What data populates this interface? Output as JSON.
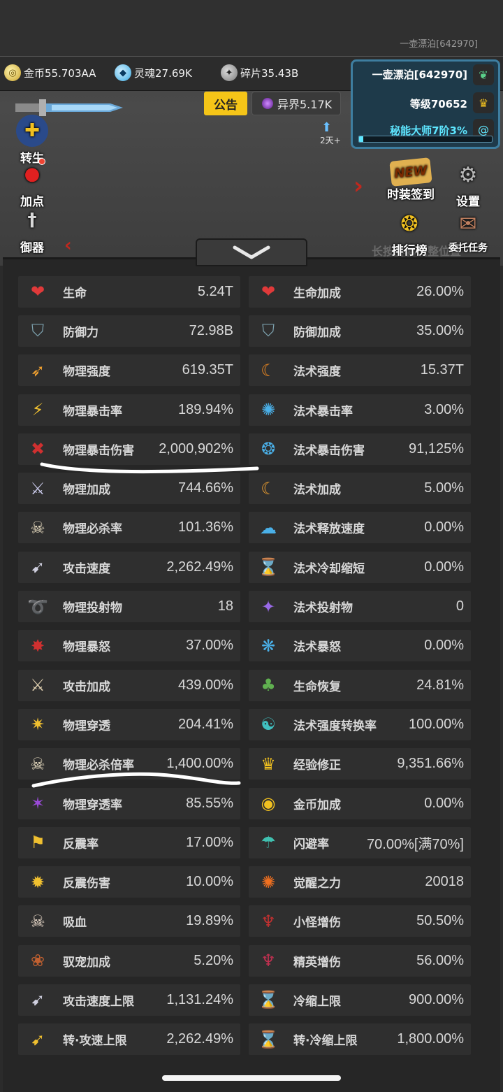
{
  "header": {
    "player_top": "一壶漂泊[642970]",
    "resources": [
      {
        "label": "金币55.703AA",
        "icon": "gold-coin-icon"
      },
      {
        "label": "灵魂27.69K",
        "icon": "soul-icon"
      },
      {
        "label": "碎片35.43B",
        "icon": "shard-icon"
      }
    ],
    "notice_label": "公告",
    "realm_label": "异界5.17K",
    "days_label": "2天+"
  },
  "player_panel": {
    "name": "一壶漂泊[642970]",
    "level": "等级70652",
    "rank": "秘能大师7阶3%",
    "progress_percent": 3
  },
  "side_buttons": [
    {
      "label": "转生"
    },
    {
      "label": "加点"
    },
    {
      "label": "御器"
    }
  ],
  "right_buttons": {
    "new_tag": "NEW",
    "sign_in": "时装签到",
    "settings": "设置",
    "leaderboard": "排行榜",
    "commission": "委托任务",
    "hint": "长按屏幕调整位置"
  },
  "stats": [
    [
      {
        "label": "生命",
        "value": "5.24T",
        "icon": "heart-icon"
      },
      {
        "label": "生命加成",
        "value": "26.00%",
        "icon": "heart-plus-icon"
      }
    ],
    [
      {
        "label": "防御力",
        "value": "72.98B",
        "icon": "shield-icon"
      },
      {
        "label": "防御加成",
        "value": "35.00%",
        "icon": "shield-plus-icon"
      }
    ],
    [
      {
        "label": "物理强度",
        "value": "619.35T",
        "icon": "physical-power-icon"
      },
      {
        "label": "法术强度",
        "value": "15.37T",
        "icon": "spell-power-icon"
      }
    ],
    [
      {
        "label": "物理暴击率",
        "value": "189.94%",
        "icon": "physical-crit-icon"
      },
      {
        "label": "法术暴击率",
        "value": "3.00%",
        "icon": "spell-crit-icon"
      }
    ],
    [
      {
        "label": "物理暴击伤害",
        "value": "2,000,902%",
        "icon": "physical-crit-damage-icon"
      },
      {
        "label": "法术暴击伤害",
        "value": "91,125%",
        "icon": "spell-crit-damage-icon"
      }
    ],
    [
      {
        "label": "物理加成",
        "value": "744.66%",
        "icon": "sword-plus-icon"
      },
      {
        "label": "法术加成",
        "value": "5.00%",
        "icon": "spell-plus-icon"
      }
    ],
    [
      {
        "label": "物理必杀率",
        "value": "101.36%",
        "icon": "skull-icon"
      },
      {
        "label": "法术释放速度",
        "value": "0.00%",
        "icon": "cast-speed-icon"
      }
    ],
    [
      {
        "label": "攻击速度",
        "value": "2,262.49%",
        "icon": "attack-speed-icon"
      },
      {
        "label": "法术冷却缩短",
        "value": "0.00%",
        "icon": "hourglass-icon"
      }
    ],
    [
      {
        "label": "物理投射物",
        "value": "18",
        "icon": "projectile-icon"
      },
      {
        "label": "法术投射物",
        "value": "0",
        "icon": "spell-projectile-icon"
      }
    ],
    [
      {
        "label": "物理暴怒",
        "value": "37.00%",
        "icon": "physical-rage-icon"
      },
      {
        "label": "法术暴怒",
        "value": "0.00%",
        "icon": "spell-rage-icon"
      }
    ],
    [
      {
        "label": "攻击加成",
        "value": "439.00%",
        "icon": "crossed-swords-icon"
      },
      {
        "label": "生命恢复",
        "value": "24.81%",
        "icon": "sprout-icon"
      }
    ],
    [
      {
        "label": "物理穿透",
        "value": "204.41%",
        "icon": "penetration-icon"
      },
      {
        "label": "法术强度转换率",
        "value": "100.00%",
        "icon": "conversion-icon"
      }
    ],
    [
      {
        "label": "物理必杀倍率",
        "value": "1,400.00%",
        "icon": "skull-dagger-icon"
      },
      {
        "label": "经验修正",
        "value": "9,351.66%",
        "icon": "crown-icon"
      }
    ],
    [
      {
        "label": "物理穿透率",
        "value": "85.55%",
        "icon": "penetration-rate-icon"
      },
      {
        "label": "金币加成",
        "value": "0.00%",
        "icon": "coins-icon"
      }
    ],
    [
      {
        "label": "反震率",
        "value": "17.00%",
        "icon": "reflect-icon"
      },
      {
        "label": "闪避率",
        "value": "70.00%[满70%]",
        "icon": "dodge-icon"
      }
    ],
    [
      {
        "label": "反震伤害",
        "value": "10.00%",
        "icon": "reflect-damage-icon"
      },
      {
        "label": "觉醒之力",
        "value": "20018",
        "icon": "awaken-icon"
      }
    ],
    [
      {
        "label": "吸血",
        "value": "19.89%",
        "icon": "lifesteal-icon"
      },
      {
        "label": "小怪增伤",
        "value": "50.50%",
        "icon": "demon-icon"
      }
    ],
    [
      {
        "label": "驭宠加成",
        "value": "5.20%",
        "icon": "paw-icon"
      },
      {
        "label": "精英增伤",
        "value": "56.00%",
        "icon": "elite-demon-icon"
      }
    ],
    [
      {
        "label": "攻击速度上限",
        "value": "1,131.24%",
        "icon": "attack-speed-cap-icon"
      },
      {
        "label": "冷缩上限",
        "value": "900.00%",
        "icon": "cooldown-cap-icon"
      }
    ],
    [
      {
        "label": "转·攻速上限",
        "value": "2,262.49%",
        "icon": "rebirth-attack-speed-cap-icon"
      },
      {
        "label": "转·冷缩上限",
        "value": "1,800.00%",
        "icon": "rebirth-cooldown-cap-icon"
      }
    ]
  ],
  "icon_glyphs": {
    "heart-icon": "❤",
    "heart-plus-icon": "❤",
    "shield-icon": "⛉",
    "shield-plus-icon": "⛉",
    "physical-power-icon": "➶",
    "spell-power-icon": "☾",
    "physical-crit-icon": "⚡",
    "spell-crit-icon": "✺",
    "physical-crit-damage-icon": "✖",
    "spell-crit-damage-icon": "❂",
    "sword-plus-icon": "⚔",
    "spell-plus-icon": "☾",
    "skull-icon": "☠",
    "cast-speed-icon": "☁",
    "attack-speed-icon": "➹",
    "hourglass-icon": "⌛",
    "projectile-icon": "➰",
    "spell-projectile-icon": "✦",
    "physical-rage-icon": "✸",
    "spell-rage-icon": "❋",
    "crossed-swords-icon": "⚔",
    "sprout-icon": "♣",
    "penetration-icon": "✷",
    "conversion-icon": "☯",
    "skull-dagger-icon": "☠",
    "crown-icon": "♛",
    "penetration-rate-icon": "✶",
    "coins-icon": "◉",
    "reflect-icon": "⚑",
    "dodge-icon": "☂",
    "reflect-damage-icon": "✹",
    "awaken-icon": "✺",
    "lifesteal-icon": "☠",
    "demon-icon": "♆",
    "paw-icon": "❀",
    "elite-demon-icon": "♆",
    "attack-speed-cap-icon": "➹",
    "cooldown-cap-icon": "⌛",
    "rebirth-attack-speed-cap-icon": "➹",
    "rebirth-cooldown-cap-icon": "⌛"
  },
  "icon_colors": {
    "heart-icon": "#e03a3a",
    "heart-plus-icon": "#e03a3a",
    "shield-icon": "#7ea3b0",
    "shield-plus-icon": "#7ea3b0",
    "physical-power-icon": "#f0a030",
    "spell-power-icon": "#f08a20",
    "physical-crit-icon": "#f0c030",
    "spell-crit-icon": "#4ab0e8",
    "physical-crit-damage-icon": "#d03030",
    "spell-crit-damage-icon": "#4ab0e8",
    "sword-plus-icon": "#c8c8e8",
    "spell-plus-icon": "#f0a030",
    "skull-icon": "#e8dcc0",
    "cast-speed-icon": "#4ab0e8",
    "attack-speed-icon": "#d0d0e0",
    "hourglass-icon": "#c89060",
    "projectile-icon": "#f09030",
    "spell-projectile-icon": "#9a6ae8",
    "physical-rage-icon": "#d03030",
    "spell-rage-icon": "#4ab0e8",
    "crossed-swords-icon": "#e0d0b0",
    "sprout-icon": "#60b050",
    "penetration-icon": "#f0c030",
    "conversion-icon": "#40c0c0",
    "skull-dagger-icon": "#e8dcc0",
    "crown-icon": "#f0c020",
    "penetration-rate-icon": "#9a4ad8",
    "coins-icon": "#f0c020",
    "reflect-icon": "#f0c030",
    "dodge-icon": "#40c0b0",
    "reflect-damage-icon": "#f0c030",
    "awaken-icon": "#f07020",
    "lifesteal-icon": "#e8d8c8",
    "demon-icon": "#c03030",
    "paw-icon": "#c06030",
    "elite-demon-icon": "#c03050",
    "attack-speed-cap-icon": "#d0d0e0",
    "cooldown-cap-icon": "#c89060",
    "rebirth-attack-speed-cap-icon": "#f0c030",
    "rebirth-cooldown-cap-icon": "#f0c030"
  }
}
